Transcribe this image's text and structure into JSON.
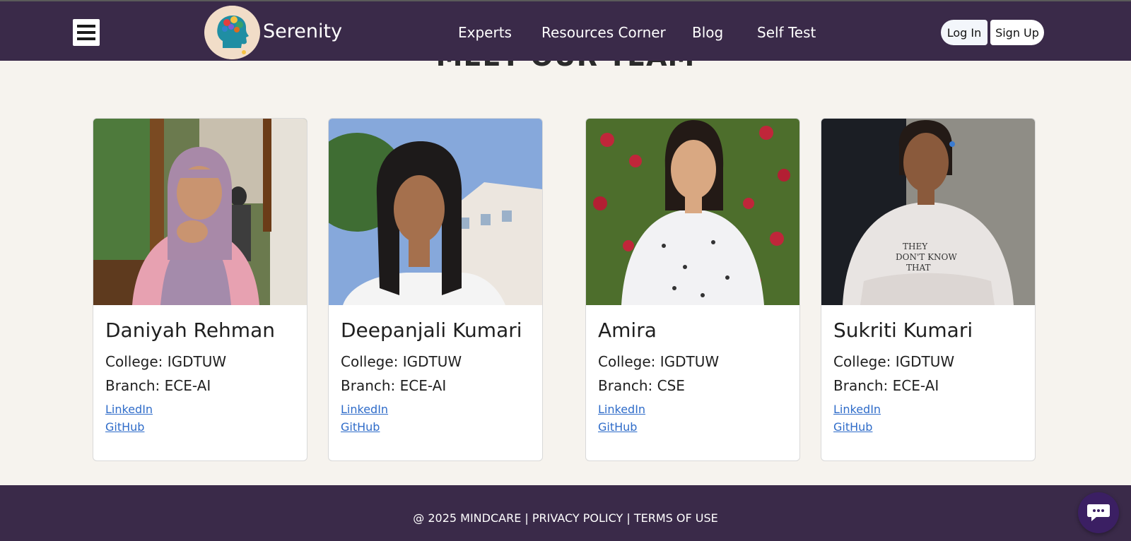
{
  "nav": {
    "brand": "Serenity",
    "links": [
      "Experts",
      "Resources Corner",
      "Blog",
      "Self Test"
    ],
    "login_label": "Log In",
    "signup_label": "Sign Up",
    "menu_icon": "hamburger-menu-icon",
    "logo_icon": "head-mind-logo-icon"
  },
  "section": {
    "title": "MEET OUR TEAM"
  },
  "team": [
    {
      "name": "Daniyah Rehman",
      "college": "College: IGDTUW",
      "branch": "Branch: ECE-AI",
      "linkedin": "LinkedIn",
      "github": "GitHub"
    },
    {
      "name": "Deepanjali Kumari",
      "college": "College: IGDTUW",
      "branch": "Branch: ECE-AI",
      "linkedin": "LinkedIn",
      "github": "GitHub"
    },
    {
      "name": "Amira",
      "college": "College: IGDTUW",
      "branch": "Branch: CSE",
      "linkedin": "LinkedIn",
      "github": "GitHub"
    },
    {
      "name": "Sukriti Kumari",
      "college": "College: IGDTUW",
      "branch": "Branch: ECE-AI",
      "linkedin": "LinkedIn",
      "github": "GitHub"
    }
  ],
  "footer": {
    "copyright": "@ 2025 MINDCARE",
    "separator": "|",
    "privacy": "PRIVACY POLICY",
    "terms": "TERMS OF USE"
  },
  "chat": {
    "icon": "chat-bubble-icon"
  },
  "colors": {
    "nav_bg": "#3a2a49",
    "page_bg": "#f6f3ee",
    "link": "#2f6cc9",
    "chat_bg": "#3b1f63"
  }
}
